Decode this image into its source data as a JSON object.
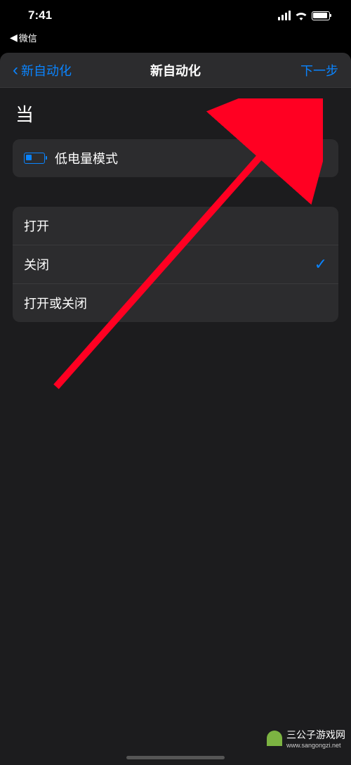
{
  "status": {
    "time": "7:41",
    "back_app": "微信"
  },
  "nav": {
    "back_label": "新自动化",
    "title": "新自动化",
    "next_label": "下一步"
  },
  "section": {
    "when_label": "当"
  },
  "trigger": {
    "label": "低电量模式"
  },
  "options": [
    {
      "label": "打开",
      "selected": false
    },
    {
      "label": "关闭",
      "selected": true
    },
    {
      "label": "打开或关闭",
      "selected": false
    }
  ],
  "watermark": {
    "brand": "三公子游戏网",
    "url": "www.sangongzi.net"
  }
}
